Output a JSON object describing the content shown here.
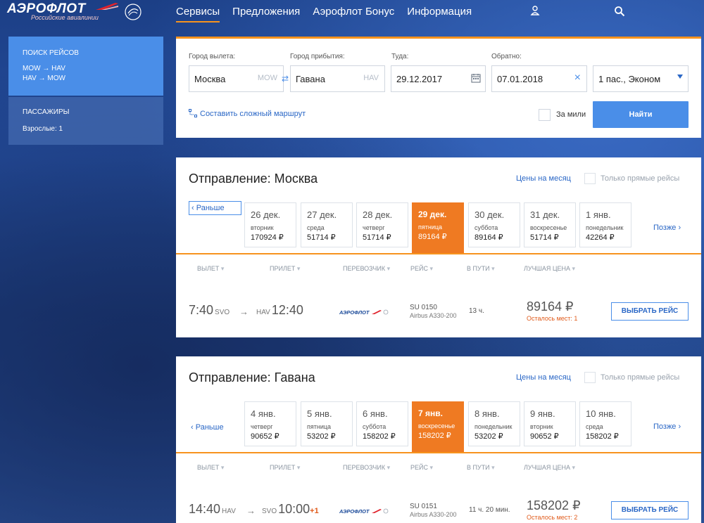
{
  "header": {
    "logo_text": "АЭРОФЛОТ",
    "logo_sub": "Российские авиалинии",
    "nav": [
      "Сервисы",
      "Предложения",
      "Аэрофлот Бонус",
      "Информация"
    ]
  },
  "sidebar": {
    "search_title": "ПОИСК РЕЙСОВ",
    "routes": [
      "MOW → HAV",
      "HAV → MOW"
    ],
    "pass_title": "ПАССАЖИРЫ",
    "pass_value": "Взрослые: 1"
  },
  "search": {
    "from_label": "Город вылета:",
    "from_value": "Москва",
    "from_code": "MOW",
    "to_label": "Город прибытия:",
    "to_value": "Гавана",
    "to_code": "HAV",
    "there_label": "Туда:",
    "there_value": "29.12.2017",
    "back_label": "Обратно:",
    "back_value": "07.01.2018",
    "pax_value": "1 пас., Эконом",
    "complex_route": "Составить сложный маршрут",
    "miles_label": "За мили",
    "find_button": "Найти"
  },
  "columns": [
    "ВЫЛЕТ",
    "ПРИЛЕТ",
    "ПЕРЕВОЗЧИК",
    "РЕЙС",
    "В ПУТИ",
    "ЛУЧШАЯ ЦЕНА"
  ],
  "outbound": {
    "title": "Отправление: Москва",
    "month_prices": "Цены на месяц",
    "direct_only": "Только прямые рейсы",
    "earlier": "Раньше",
    "later": "Позже",
    "days": [
      {
        "date": "26 дек.",
        "weekday": "вторник",
        "price": "170924 ₽"
      },
      {
        "date": "27 дек.",
        "weekday": "среда",
        "price": "51714 ₽"
      },
      {
        "date": "28 дек.",
        "weekday": "четверг",
        "price": "51714 ₽"
      },
      {
        "date": "29 дек.",
        "weekday": "пятница",
        "price": "89164 ₽"
      },
      {
        "date": "30 дек.",
        "weekday": "суббота",
        "price": "89164 ₽"
      },
      {
        "date": "31 дек.",
        "weekday": "воскресенье",
        "price": "51714 ₽"
      },
      {
        "date": "1 янв.",
        "weekday": "понедельник",
        "price": "42264 ₽"
      }
    ],
    "flight": {
      "dep_time": "7:40",
      "dep_ap": "SVO",
      "arr_ap": "HAV",
      "arr_time": "12:40",
      "plus_day": "",
      "flight_no": "SU 0150",
      "aircraft": "Airbus A330-200",
      "duration": "13 ч.",
      "price": "89164 ₽",
      "seats": "Осталось мест: 1",
      "select": "ВЫБРАТЬ РЕЙС"
    }
  },
  "inbound": {
    "title": "Отправление: Гавана",
    "month_prices": "Цены на месяц",
    "direct_only": "Только прямые рейсы",
    "earlier": "Раньше",
    "later": "Позже",
    "days": [
      {
        "date": "4 янв.",
        "weekday": "четверг",
        "price": "90652 ₽"
      },
      {
        "date": "5 янв.",
        "weekday": "пятница",
        "price": "53202 ₽"
      },
      {
        "date": "6 янв.",
        "weekday": "суббота",
        "price": "158202 ₽"
      },
      {
        "date": "7 янв.",
        "weekday": "воскресенье",
        "price": "158202 ₽"
      },
      {
        "date": "8 янв.",
        "weekday": "понедельник",
        "price": "53202 ₽"
      },
      {
        "date": "9 янв.",
        "weekday": "вторник",
        "price": "90652 ₽"
      },
      {
        "date": "10 янв.",
        "weekday": "среда",
        "price": "158202 ₽"
      }
    ],
    "flight": {
      "dep_time": "14:40",
      "dep_ap": "HAV",
      "arr_ap": "SVO",
      "arr_time": "10:00",
      "plus_day": "+1",
      "flight_no": "SU 0151",
      "aircraft": "Airbus A330-200",
      "duration": "11 ч. 20 мин.",
      "price": "158202 ₽",
      "seats": "Осталось мест: 2",
      "select": "ВЫБРАТЬ РЕЙС"
    }
  },
  "colors": {
    "accent": "#f7931e",
    "active_day": "#ef7a22",
    "primary": "#4a8ee8",
    "link": "#2a67c6"
  }
}
